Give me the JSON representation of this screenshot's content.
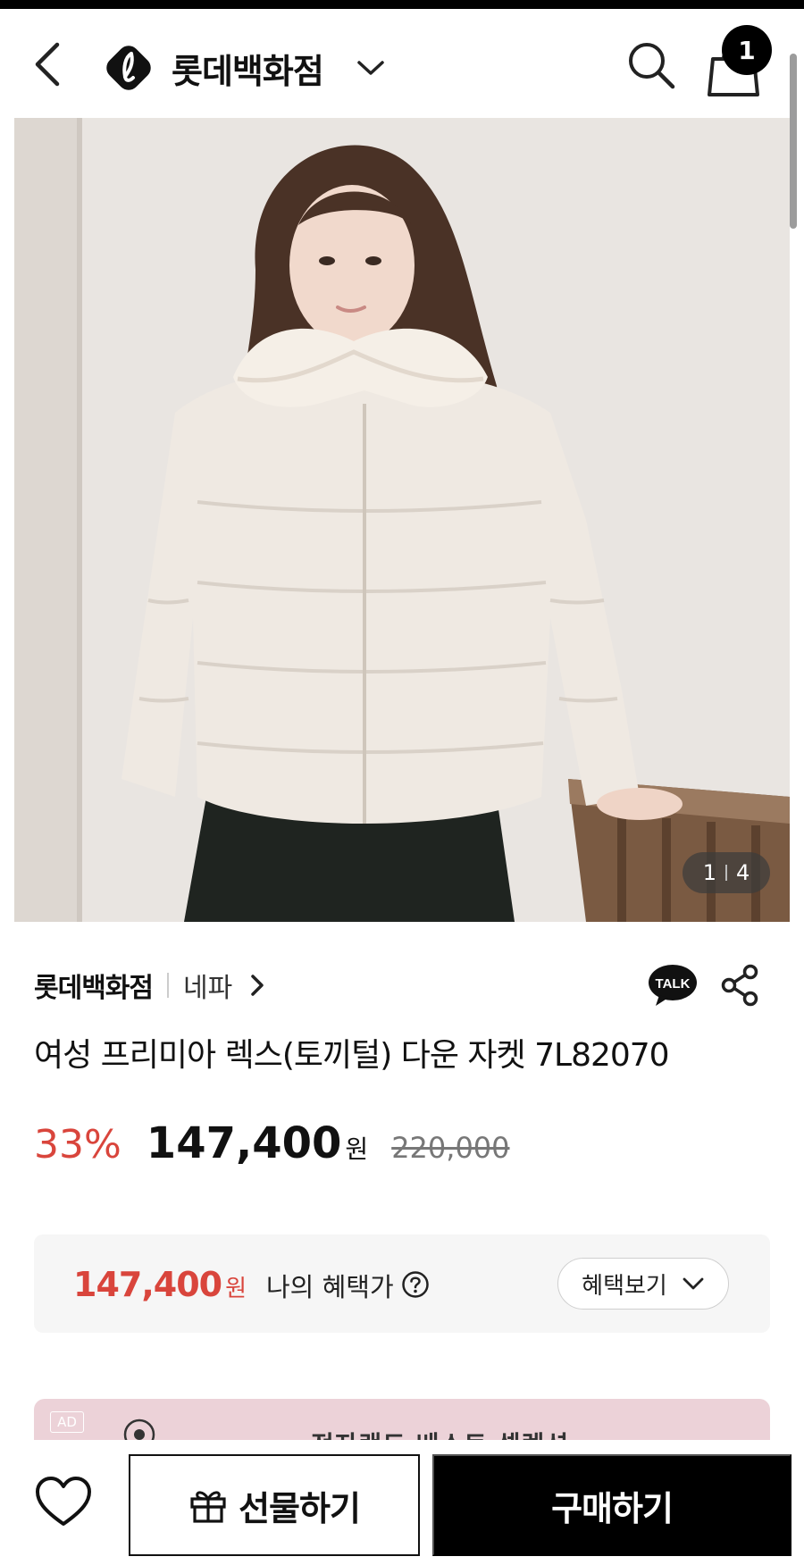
{
  "header": {
    "brand_name": "롯데백화점",
    "cart_count": "1"
  },
  "gallery": {
    "current": "1",
    "total": "4"
  },
  "product": {
    "seller": "롯데백화점",
    "brand": "네파",
    "talk_label": "TALK",
    "title": "여성 프리미아 렉스(토끼털) 다운 자켓 7L82070",
    "discount": "33%",
    "price": "147,400",
    "price_unit": "원",
    "original_price": "220,000"
  },
  "benefit": {
    "amount": "147,400",
    "unit": "원",
    "label": "나의 혜택가",
    "button_label": "혜택보기"
  },
  "ad": {
    "badge": "AD",
    "text": "전자랜드 베스트 셀렉션"
  },
  "actions": {
    "gift_label": "선물하기",
    "buy_label": "구매하기"
  },
  "colors": {
    "accent_red": "#d9453c",
    "primary_black": "#000000",
    "ad_pink": "#ecd2d8"
  }
}
